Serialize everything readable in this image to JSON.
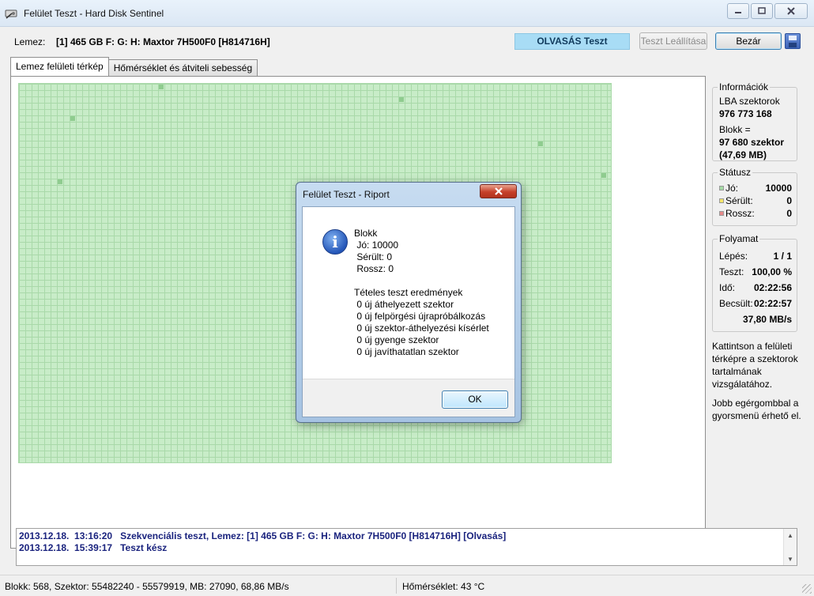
{
  "window": {
    "title": "Felület Teszt - Hard Disk Sentinel",
    "controls": [
      "minimize",
      "maximize",
      "close"
    ]
  },
  "toolbar": {
    "disk_label": "Lemez:",
    "disk_value": "[1] 465 GB F: G: H: Maxtor 7H500F0 [H814716H]",
    "mode_status": "OLVASÁS Teszt",
    "stop_button": "Teszt Leállítása",
    "close_button": "Bezár",
    "save_icon": "save-icon"
  },
  "tabs": [
    {
      "label": "Lemez felületi térkép",
      "active": true
    },
    {
      "label": "Hőmérséklet és átviteli sebesség",
      "active": false
    }
  ],
  "sector_map": {
    "status": "all good",
    "colors": {
      "good": "#c8ecc8",
      "grid": "#a9d9a9",
      "visited": "#8fcc8f"
    }
  },
  "info": {
    "title": "Információk",
    "lba_label": "LBA szektorok",
    "lba_value": "976 773 168",
    "block_label": "Blokk =",
    "block_value": "97 680 szektor",
    "block_mb": "(47,69 MB)"
  },
  "status_box": {
    "title": "Státusz",
    "rows": [
      {
        "label": "Jó:",
        "value": "10000",
        "color": "#a6dba6"
      },
      {
        "label": "Sérült:",
        "value": "0",
        "color": "#f5e66a"
      },
      {
        "label": "Rossz:",
        "value": "0",
        "color": "#e88a8a"
      }
    ]
  },
  "progress": {
    "title": "Folyamat",
    "step_label": "Lépés:",
    "step_value": "1 / 1",
    "test_label": "Teszt:",
    "test_value": "100,00 %",
    "time_label": "Idő:",
    "time_value": "02:22:56",
    "est_label": "Becsült:",
    "est_value": "02:22:57",
    "speed": "37,80 MB/s"
  },
  "hint1": "Kattintson a felületi térképre a szektorok tartalmának vizsgálatához.",
  "hint2": "Jobb egérgombbal a gyorsmenü érhető el.",
  "log": [
    "2013.12.18.  13:16:20   Szekvenciális teszt, Lemez: [1] 465 GB F: G: H: Maxtor 7H500F0 [H814716H] [Olvasás]",
    "2013.12.18.  15:39:17   Teszt kész"
  ],
  "statusbar": {
    "left": "Blokk: 568, Szektor: 55482240 - 55579919, MB: 27090, 68,86 MB/s",
    "right": "Hőmérséklet: 43  °C"
  },
  "dialog": {
    "title": "Felület Teszt - Riport",
    "icon": "info-icon",
    "blokk": "Blokk",
    "jo": " Jó: 10000",
    "serult": " Sérült: 0",
    "rossz": " Rossz: 0",
    "results_title": "Tételes teszt eredmények",
    "results": [
      " 0 új áthelyezett szektor",
      " 0 új felpörgési újrapróbálkozás",
      " 0 új szektor-áthelyezési kísérlet",
      " 0 új gyenge szektor",
      " 0 új javíthatatlan szektor"
    ],
    "ok": "OK"
  }
}
